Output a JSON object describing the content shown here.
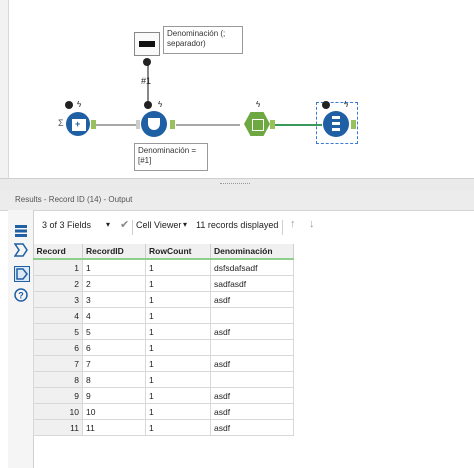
{
  "workflow": {
    "annotation_top": "Denominación (; separador)",
    "annotation_bottom": "Denominación = [#1]",
    "field_label": "#1",
    "badge_mark": "✱"
  },
  "results": {
    "title": "Results - Record ID (14) - Output",
    "fields_dropdown": "3 of 3 Fields",
    "viewer_dropdown": "Cell Viewer",
    "record_count": "11 records displayed"
  },
  "grid": {
    "columns": [
      "Record",
      "RecordID",
      "RowCount",
      "Denominación"
    ],
    "rows": [
      {
        "record": "1",
        "recordid": "1",
        "rowcount": "1",
        "denominacion": "dsfsdafsadf"
      },
      {
        "record": "2",
        "recordid": "2",
        "rowcount": "1",
        "denominacion": "sadfasdf"
      },
      {
        "record": "3",
        "recordid": "3",
        "rowcount": "1",
        "denominacion": "asdf"
      },
      {
        "record": "4",
        "recordid": "4",
        "rowcount": "1",
        "denominacion": ""
      },
      {
        "record": "5",
        "recordid": "5",
        "rowcount": "1",
        "denominacion": "asdf"
      },
      {
        "record": "6",
        "recordid": "6",
        "rowcount": "1",
        "denominacion": ""
      },
      {
        "record": "7",
        "recordid": "7",
        "rowcount": "1",
        "denominacion": "asdf"
      },
      {
        "record": "8",
        "recordid": "8",
        "rowcount": "1",
        "denominacion": ""
      },
      {
        "record": "9",
        "recordid": "9",
        "rowcount": "1",
        "denominacion": "asdf"
      },
      {
        "record": "10",
        "recordid": "10",
        "rowcount": "1",
        "denominacion": "asdf"
      },
      {
        "record": "11",
        "recordid": "11",
        "rowcount": "1",
        "denominacion": "asdf"
      }
    ]
  },
  "colors": {
    "tool_blue": "#1f5fa3",
    "tool_green": "#6ea843",
    "connector_green": "#3a9a5c",
    "header_underline": "#8ed08b"
  },
  "icons": {
    "left_panel": [
      "table-view-icon",
      "input-anchor-icon",
      "output-anchor-icon",
      "help-icon"
    ],
    "toolbar": [
      "chevron-down-icon",
      "checkmark-icon",
      "chevron-down-icon",
      "arrow-up-icon",
      "arrow-down-icon"
    ]
  }
}
